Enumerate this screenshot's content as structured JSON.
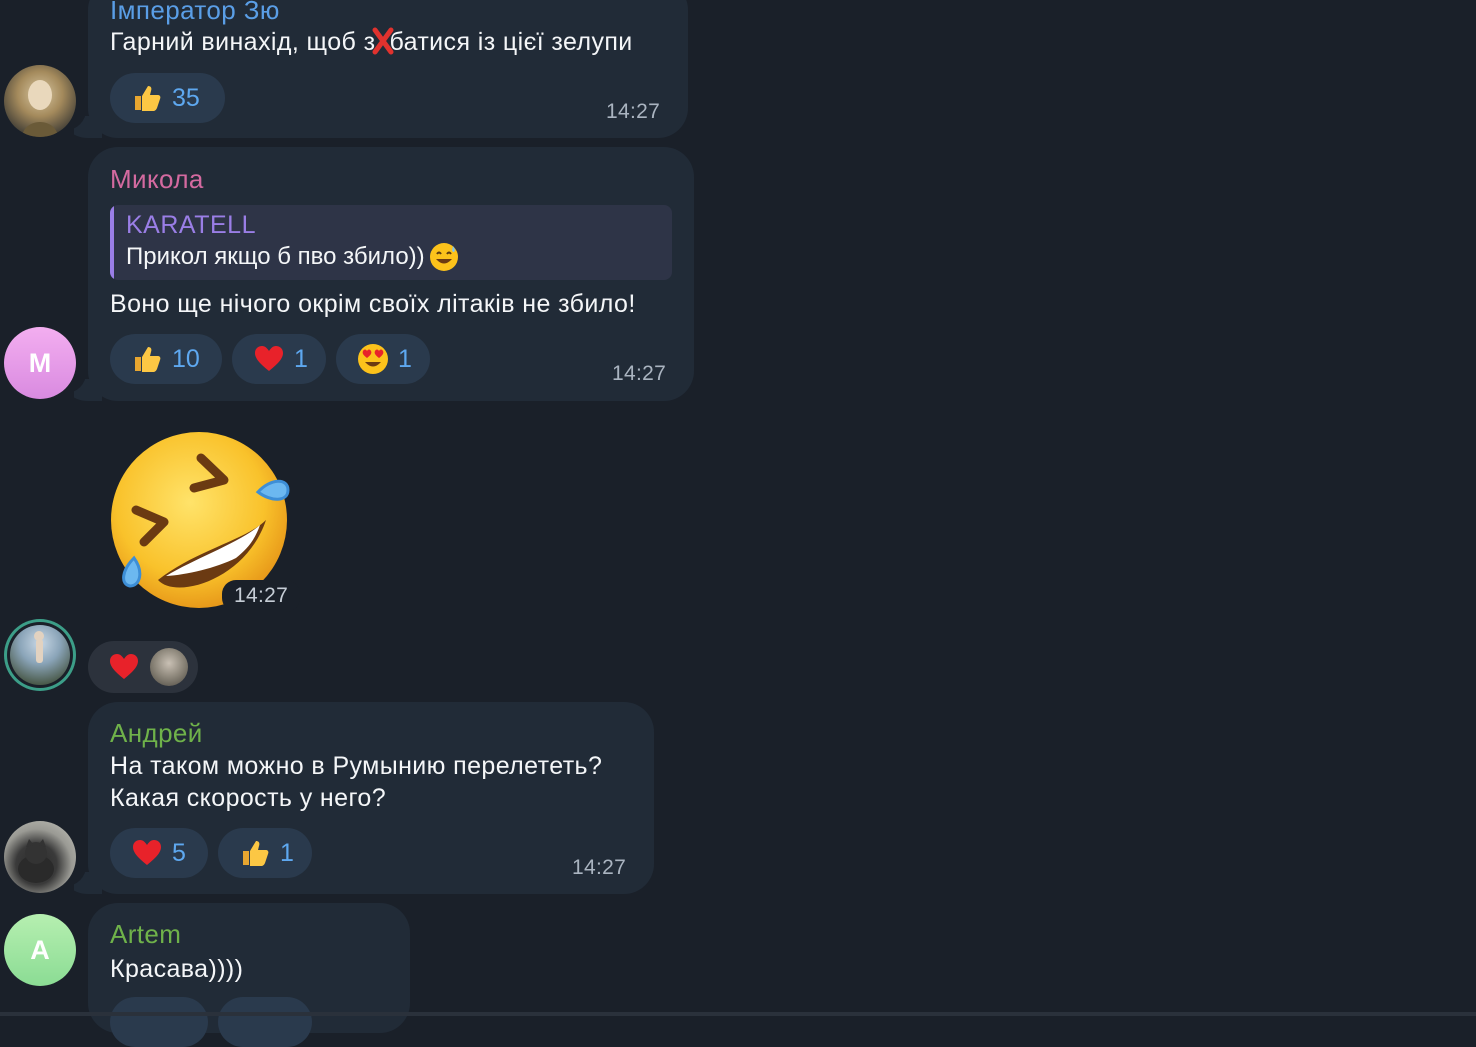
{
  "colors": {
    "background": "#1a2029",
    "bubble": "#212b37",
    "reaction_bg": "#2a3a4d",
    "reaction_count": "#5ea8f0",
    "time": "#aab4c0"
  },
  "messages": [
    {
      "sender": "Імператор Зю",
      "sender_color": "#5a9ee6",
      "text_before": "Гарний винахід, щоб з",
      "text_after": "батися із цієї зелупи",
      "censor_icon": "red-cross-mark-icon",
      "reactions": [
        {
          "icon": "thumbs-up-icon",
          "count": "35"
        }
      ],
      "time": "14:27"
    },
    {
      "sender": "Микола",
      "sender_color": "#d46aa0",
      "avatar_letter": "M",
      "reply": {
        "sender": "KARATELL",
        "text": "Прикол якщо б пво збило))",
        "emoji_icon": "grinning-sweat-emoji-icon"
      },
      "text": "Воно ще нічого окрім своїх літаків не збило!",
      "reactions": [
        {
          "icon": "thumbs-up-icon",
          "count": "10"
        },
        {
          "icon": "red-heart-icon",
          "count": "1"
        },
        {
          "icon": "heart-eyes-emoji-icon",
          "count": "1"
        }
      ],
      "time": "14:27"
    },
    {
      "sticker_icon": "rolling-on-floor-laughing-sticker-icon",
      "time": "14:27",
      "reaction_icon": "red-heart-icon"
    },
    {
      "sender": "Андрей",
      "sender_color": "#6fb24a",
      "text_lines": [
        "На таком можно в Румынию перелететь?",
        "Какая скорость у него?"
      ],
      "reactions": [
        {
          "icon": "red-heart-icon",
          "count": "5"
        },
        {
          "icon": "thumbs-up-icon",
          "count": "1"
        }
      ],
      "time": "14:27"
    },
    {
      "sender": "Artem",
      "sender_color": "#6fb24a",
      "avatar_letter": "A",
      "text": "Красава))))"
    }
  ]
}
